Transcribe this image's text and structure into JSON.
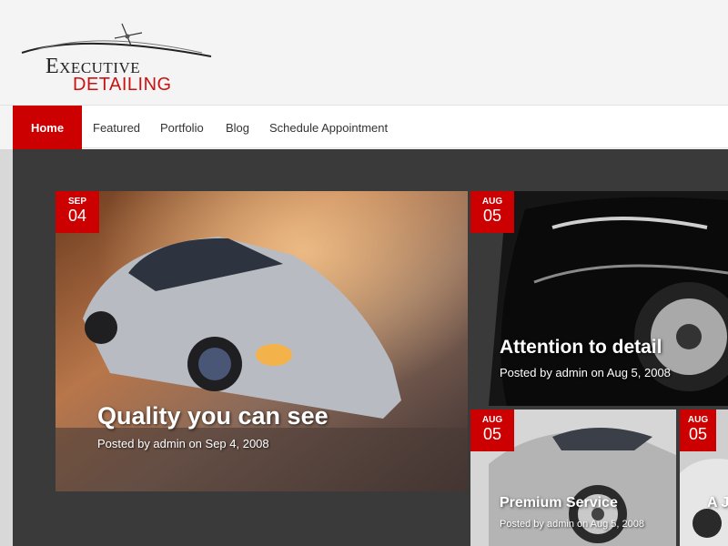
{
  "brand": {
    "line1": "Executive",
    "line2": "DETAILING"
  },
  "nav": {
    "items": [
      {
        "label": "Home",
        "active": true
      },
      {
        "label": "Featured"
      },
      {
        "label": "Portfolio"
      },
      {
        "label": "Blog"
      },
      {
        "label": "Schedule Appointment"
      }
    ]
  },
  "posts": [
    {
      "month": "SEP",
      "day": "04",
      "title": "Quality you can see",
      "meta": "Posted by admin on Sep 4, 2008"
    },
    {
      "month": "AUG",
      "day": "05",
      "title": "Attention to detail",
      "meta": "Posted by admin on Aug 5, 2008"
    },
    {
      "month": "AUG",
      "day": "05",
      "title": "Premium Service",
      "meta": "Posted by admin on Aug 5, 2008"
    },
    {
      "month": "AUG",
      "day": "05",
      "title": "A J",
      "meta": ""
    }
  ],
  "colors": {
    "accent": "#cc0000",
    "dark_bg": "#3a3a3a"
  }
}
